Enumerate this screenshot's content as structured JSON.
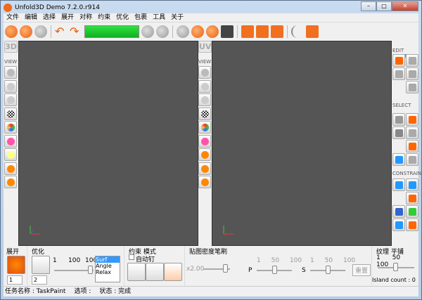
{
  "window": {
    "title": "Unfold3D Demo 7.2.0.r914",
    "min": "–",
    "max": "□",
    "close": "✕"
  },
  "menu": [
    "文件",
    "编辑",
    "选择",
    "展开",
    "对称",
    "约束",
    "优化",
    "包裹",
    "工具",
    "关于"
  ],
  "left_viewport": {
    "label": "3D",
    "view_label": "VIEW"
  },
  "uv_viewport": {
    "label": "UV",
    "view_label": "VIEW"
  },
  "right_panel": {
    "edit_mode": "EDIT MODE",
    "select": "SELECT",
    "constrain": "CONSTRAIN"
  },
  "colors": {
    "accent": "#f06a1a",
    "progress": "#20c830",
    "viewport": "#555555"
  },
  "bottom": {
    "unfold": {
      "title": "展开",
      "iterations": "1"
    },
    "optimize": {
      "title": "优化",
      "iterations": "2",
      "ticks": [
        "1",
        "100",
        "100"
      ],
      "options": [
        "Surf",
        "Angle",
        "Relax"
      ],
      "selected": "Surf"
    },
    "constraint": {
      "title": "约束 模式",
      "auto_pin": "自动钉"
    },
    "density": {
      "title": "贴图密度笔刷",
      "value": "x2.00",
      "p_label": "P",
      "s_label": "S",
      "p_ticks": [
        "1",
        "50",
        "100"
      ],
      "s_ticks": [
        "1",
        "50",
        "100"
      ],
      "reset": "重置"
    },
    "tile": {
      "title": "纹理 平铺",
      "ticks": [
        "1",
        "50",
        "100"
      ],
      "island_count": "Island count : 0"
    }
  },
  "status": {
    "task": "任务名称 : TaskPaint",
    "options": "选项 :",
    "state": "状态 : 完成"
  }
}
